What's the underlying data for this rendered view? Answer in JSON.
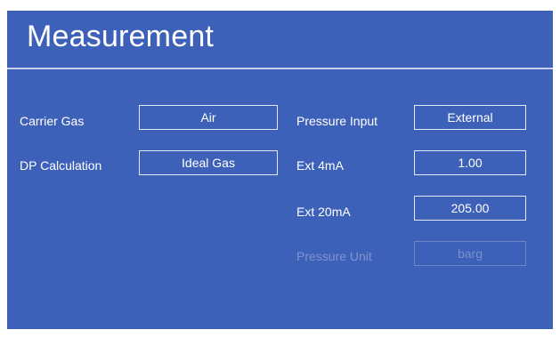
{
  "header": {
    "title": "Measurement"
  },
  "colors": {
    "background": "#3d61b8",
    "text": "#ffffff",
    "field_border": "#e2e8f7",
    "disabled_text": "#7f95cd"
  },
  "left_column": {
    "carrier_gas": {
      "label": "Carrier Gas",
      "value": "Air"
    },
    "dp_calculation": {
      "label": "DP Calculation",
      "value": "Ideal Gas"
    }
  },
  "right_column": {
    "pressure_input": {
      "label": "Pressure Input",
      "value": "External"
    },
    "ext_4ma": {
      "label": "Ext 4mA",
      "value": "1.00"
    },
    "ext_20ma": {
      "label": "Ext 20mA",
      "value": "205.00"
    },
    "pressure_unit": {
      "label": "Pressure Unit",
      "value": "barg",
      "enabled": false
    }
  }
}
